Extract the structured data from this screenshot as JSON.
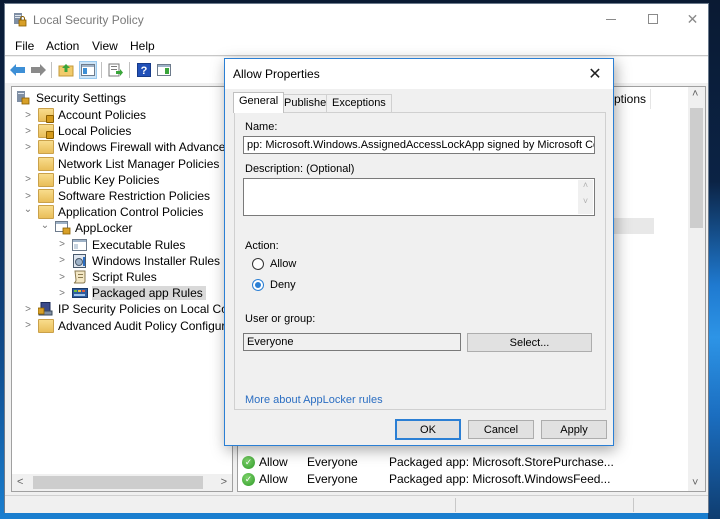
{
  "window": {
    "title": "Local Security Policy",
    "controls": {
      "minimize": "—",
      "maximize": "☐",
      "close": "✕"
    }
  },
  "menu": [
    "File",
    "Action",
    "View",
    "Help"
  ],
  "toolbar": [
    {
      "name": "back",
      "icon": "back-arrow-icon"
    },
    {
      "name": "forward",
      "icon": "forward-arrow-icon"
    },
    {
      "name": "up-one-level",
      "icon": "up-folder-icon"
    },
    {
      "name": "show-hide-console-tree",
      "icon": "console-tree-icon"
    },
    {
      "name": "export-list",
      "icon": "export-list-icon"
    },
    {
      "name": "help",
      "icon": "help-icon"
    },
    {
      "name": "show-action-pane",
      "icon": "action-pane-icon"
    }
  ],
  "tree": {
    "root": "Security Settings",
    "items": [
      {
        "label": "Account Policies",
        "expander": ">",
        "icon": "locked-folder"
      },
      {
        "label": "Local Policies",
        "expander": ">",
        "icon": "locked-folder"
      },
      {
        "label": "Windows Firewall with Advanced Sec",
        "expander": ">",
        "icon": "folder"
      },
      {
        "label": "Network List Manager Policies",
        "expander": "",
        "icon": "folder"
      },
      {
        "label": "Public Key Policies",
        "expander": ">",
        "icon": "folder"
      },
      {
        "label": "Software Restriction Policies",
        "expander": ">",
        "icon": "folder"
      },
      {
        "label": "Application Control Policies",
        "expander": "⌄",
        "icon": "folder"
      },
      {
        "label": "AppLocker",
        "expander": "⌄",
        "icon": "applocker"
      },
      {
        "label": "Executable Rules",
        "expander": ">",
        "icon": "rules"
      },
      {
        "label": "Windows Installer Rules",
        "expander": ">",
        "icon": "installer"
      },
      {
        "label": "Script Rules",
        "expander": ">",
        "icon": "script"
      },
      {
        "label": "Packaged app Rules",
        "expander": ">",
        "icon": "packaged-app",
        "selected": true
      },
      {
        "label": "IP Security Policies on Local Comput",
        "expander": ">",
        "icon": "ip-security"
      },
      {
        "label": "Advanced Audit Policy Configuration",
        "expander": ">",
        "icon": "folder"
      }
    ]
  },
  "list": {
    "header_fragment": "ptions",
    "rows": [
      {
        "action": "Allow",
        "user": "Everyone",
        "condition": "Packaged app: Microsoft.StorePurchase..."
      },
      {
        "action": "Allow",
        "user": "Everyone",
        "condition": "Packaged app: Microsoft.WindowsFeed..."
      }
    ]
  },
  "dialog": {
    "title": "Allow Properties",
    "close": "✕",
    "tabs": [
      "General",
      "Publisher",
      "Exceptions"
    ],
    "active_tab": "General",
    "name_label": "Name:",
    "name_value": "pp: Microsoft.Windows.AssignedAccessLockApp signed by Microsoft Corporation",
    "description_label": "Description: (Optional)",
    "description_value": "",
    "action_label": "Action:",
    "action_options": [
      "Allow",
      "Deny"
    ],
    "action_selected": "Deny",
    "user_label": "User or group:",
    "user_value": "Everyone",
    "select_button": "Select...",
    "help_link": "More about AppLocker rules",
    "buttons": {
      "ok": "OK",
      "cancel": "Cancel",
      "apply": "Apply"
    }
  }
}
